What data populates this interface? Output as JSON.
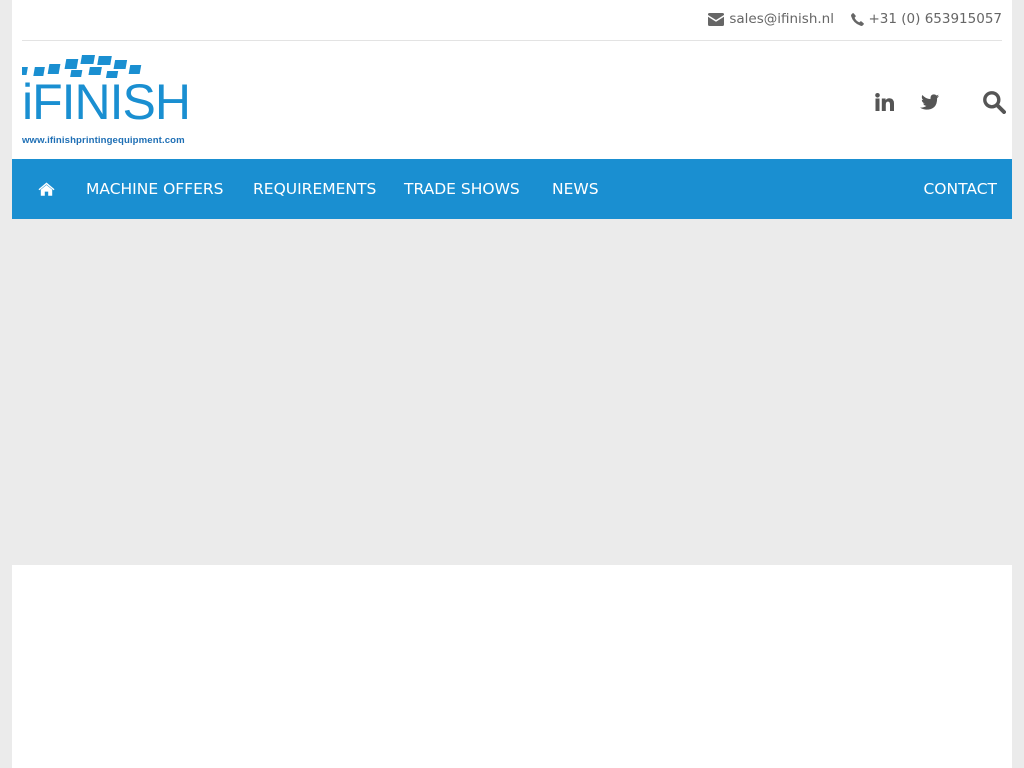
{
  "topbar": {
    "email": "sales@ifinish.nl",
    "phone": "+31 (0) 653915057"
  },
  "logo": {
    "wordmark": "iFINISH",
    "url_text": "www.ifinishprintingequipment.com"
  },
  "social": {
    "linkedin_icon": "linkedin-icon",
    "twitter_icon": "twitter-icon",
    "search_icon": "search-icon"
  },
  "nav": {
    "home_icon": "home-icon",
    "items": [
      {
        "label": "MACHINE OFFERS"
      },
      {
        "label": "REQUIREMENTS"
      },
      {
        "label": "TRADE SHOWS"
      },
      {
        "label": "NEWS"
      }
    ],
    "contact_label": "CONTACT"
  },
  "colors": {
    "brand_blue": "#1a8fd1",
    "dark_blue": "#1e6fb5",
    "text_gray": "#666666",
    "icon_gray": "#555555",
    "page_bg": "#ebebeb"
  }
}
